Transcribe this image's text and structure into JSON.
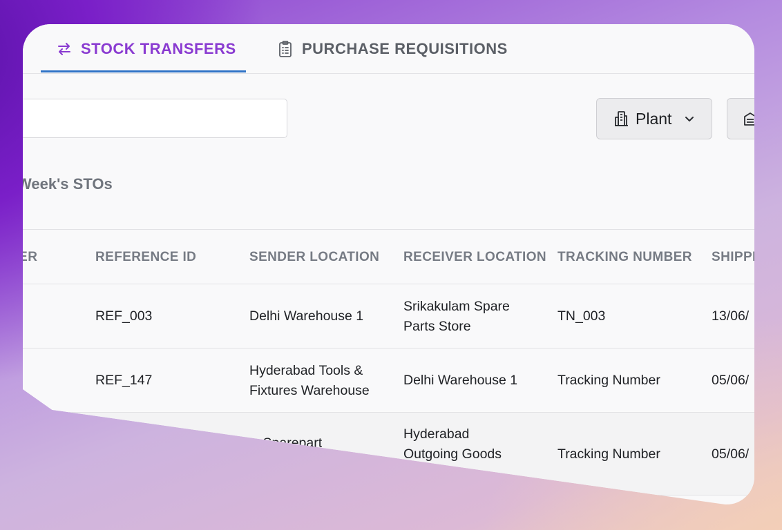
{
  "tabs": [
    {
      "label": "STOCK TRANSFERS",
      "icon": "transfer-arrows-icon",
      "active": true
    },
    {
      "label": "PURCHASE REQUISITIONS",
      "icon": "clipboard-icon",
      "active": false
    }
  ],
  "colors": {
    "accent": "#8a3bd1",
    "underline": "#2f73c6"
  },
  "search": {
    "value": "",
    "placeholder": ""
  },
  "filters": {
    "plant_label": "Plant"
  },
  "section": {
    "title": "Week's STOs"
  },
  "table": {
    "headers": [
      "BER",
      "REFERENCE ID",
      "SENDER LOCATION",
      "RECEIVER LOCATION",
      "TRACKING NUMBER",
      "SHIPPI"
    ],
    "rows": [
      [
        "",
        "REF_003",
        "Delhi Warehouse 1",
        "Srikakulam Spare\nParts Store",
        "TN_003",
        "13/06/"
      ],
      [
        "",
        "REF_147",
        "Hyderabad Tools &\nFixtures Warehouse",
        "Delhi Warehouse 1",
        "Tracking Number",
        "05/06/"
      ],
      [
        "",
        "",
        "…Sparepart",
        "Hyderabad\nOutgoing Goods",
        "Tracking Number",
        "05/06/"
      ]
    ]
  }
}
